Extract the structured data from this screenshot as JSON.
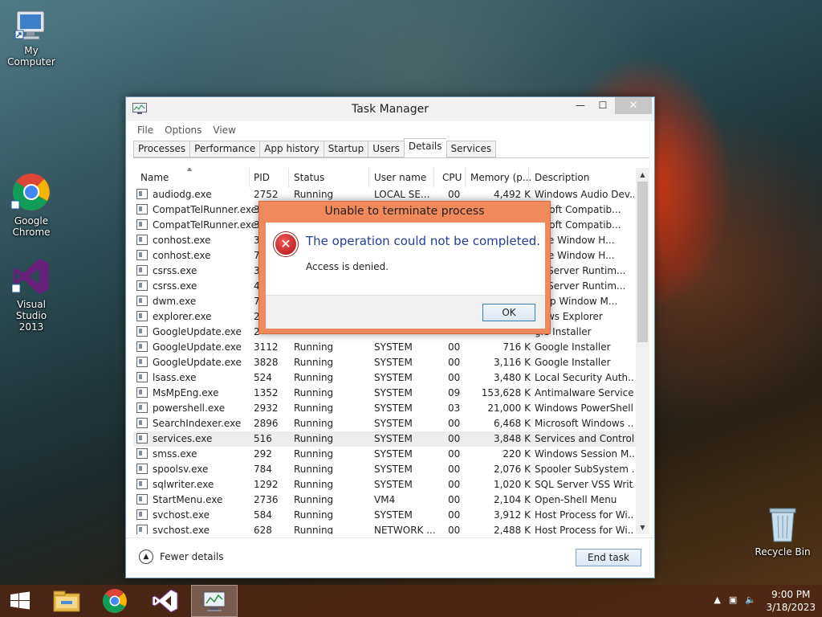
{
  "desktop": {
    "icons": [
      {
        "label": "My Computer",
        "icon": "computer-icon"
      },
      {
        "label": "Google Chrome",
        "icon": "chrome-icon"
      },
      {
        "label": "Visual Studio 2013",
        "icon": "visual-studio-icon"
      },
      {
        "label": "Recycle Bin",
        "icon": "recycle-bin-icon"
      }
    ]
  },
  "task_manager": {
    "title": "Task Manager",
    "window_buttons": {
      "minimize": "—",
      "maximize": "☐",
      "close": "✕"
    },
    "menu": [
      "File",
      "Options",
      "View"
    ],
    "tabs": [
      "Processes",
      "Performance",
      "App history",
      "Startup",
      "Users",
      "Details",
      "Services"
    ],
    "active_tab": "Details",
    "columns": [
      "Name",
      "PID",
      "Status",
      "User name",
      "CPU",
      "Memory (p...",
      "Description"
    ],
    "rows": [
      {
        "name": "audiodg.exe",
        "pid": "2752",
        "status": "Running",
        "user": "LOCAL SE...",
        "cpu": "00",
        "mem": "4,492 K",
        "desc": "Windows Audio Dev..."
      },
      {
        "name": "CompatTelRunner.exe",
        "pid": "3",
        "status": "",
        "user": "",
        "cpu": "",
        "mem": "",
        "desc": "rosoft Compatib..."
      },
      {
        "name": "CompatTelRunner.exe",
        "pid": "3",
        "status": "",
        "user": "",
        "cpu": "",
        "mem": "",
        "desc": "rosoft Compatib..."
      },
      {
        "name": "conhost.exe",
        "pid": "3",
        "status": "",
        "user": "",
        "cpu": "",
        "mem": "",
        "desc": "sole Window H..."
      },
      {
        "name": "conhost.exe",
        "pid": "7",
        "status": "",
        "user": "",
        "cpu": "",
        "mem": "",
        "desc": "sole Window H..."
      },
      {
        "name": "csrss.exe",
        "pid": "3",
        "status": "",
        "user": "",
        "cpu": "",
        "mem": "",
        "desc": "nt Server Runtim..."
      },
      {
        "name": "csrss.exe",
        "pid": "4",
        "status": "",
        "user": "",
        "cpu": "",
        "mem": "",
        "desc": "nt Server Runtim..."
      },
      {
        "name": "dwm.exe",
        "pid": "7",
        "status": "",
        "user": "",
        "cpu": "",
        "mem": "",
        "desc": "ktop Window M..."
      },
      {
        "name": "explorer.exe",
        "pid": "2",
        "status": "",
        "user": "",
        "cpu": "",
        "mem": "",
        "desc": "dows Explorer"
      },
      {
        "name": "GoogleUpdate.exe",
        "pid": "2",
        "status": "",
        "user": "",
        "cpu": "",
        "mem": "",
        "desc": "gle Installer"
      },
      {
        "name": "GoogleUpdate.exe",
        "pid": "3112",
        "status": "Running",
        "user": "SYSTEM",
        "cpu": "00",
        "mem": "716 K",
        "desc": "Google Installer"
      },
      {
        "name": "GoogleUpdate.exe",
        "pid": "3828",
        "status": "Running",
        "user": "SYSTEM",
        "cpu": "00",
        "mem": "3,116 K",
        "desc": "Google Installer"
      },
      {
        "name": "lsass.exe",
        "pid": "524",
        "status": "Running",
        "user": "SYSTEM",
        "cpu": "00",
        "mem": "3,480 K",
        "desc": "Local Security Auth..."
      },
      {
        "name": "MsMpEng.exe",
        "pid": "1352",
        "status": "Running",
        "user": "SYSTEM",
        "cpu": "09",
        "mem": "153,628 K",
        "desc": "Antimalware Service..."
      },
      {
        "name": "powershell.exe",
        "pid": "2932",
        "status": "Running",
        "user": "SYSTEM",
        "cpu": "03",
        "mem": "21,000 K",
        "desc": "Windows PowerShell"
      },
      {
        "name": "SearchIndexer.exe",
        "pid": "2896",
        "status": "Running",
        "user": "SYSTEM",
        "cpu": "00",
        "mem": "6,468 K",
        "desc": "Microsoft Windows ..."
      },
      {
        "name": "services.exe",
        "pid": "516",
        "status": "Running",
        "user": "SYSTEM",
        "cpu": "00",
        "mem": "3,848 K",
        "desc": "Services and Control..."
      },
      {
        "name": "smss.exe",
        "pid": "292",
        "status": "Running",
        "user": "SYSTEM",
        "cpu": "00",
        "mem": "220 K",
        "desc": "Windows Session M..."
      },
      {
        "name": "spoolsv.exe",
        "pid": "784",
        "status": "Running",
        "user": "SYSTEM",
        "cpu": "00",
        "mem": "2,076 K",
        "desc": "Spooler SubSystem ..."
      },
      {
        "name": "sqlwriter.exe",
        "pid": "1292",
        "status": "Running",
        "user": "SYSTEM",
        "cpu": "00",
        "mem": "1,020 K",
        "desc": "SQL Server VSS Writ..."
      },
      {
        "name": "StartMenu.exe",
        "pid": "2736",
        "status": "Running",
        "user": "VM4",
        "cpu": "00",
        "mem": "2,104 K",
        "desc": "Open-Shell Menu"
      },
      {
        "name": "svchost.exe",
        "pid": "584",
        "status": "Running",
        "user": "SYSTEM",
        "cpu": "00",
        "mem": "3,912 K",
        "desc": "Host Process for Wi..."
      },
      {
        "name": "svchost.exe",
        "pid": "628",
        "status": "Running",
        "user": "NETWORK ...",
        "cpu": "00",
        "mem": "2,488 K",
        "desc": "Host Process for Wi..."
      }
    ],
    "selected_row": "services.exe",
    "fewer_details": "Fewer details",
    "end_task": "End task"
  },
  "dialog": {
    "title": "Unable to terminate process",
    "main_instruction": "The operation could not be completed.",
    "content": "Access is denied.",
    "ok": "OK",
    "title_color": "#f08a5d"
  },
  "taskbar": {
    "items": [
      "start-icon",
      "file-explorer-icon",
      "chrome-icon",
      "visual-studio-icon",
      "task-manager-icon"
    ],
    "time": "9:00 PM",
    "date": "3/18/2023"
  }
}
